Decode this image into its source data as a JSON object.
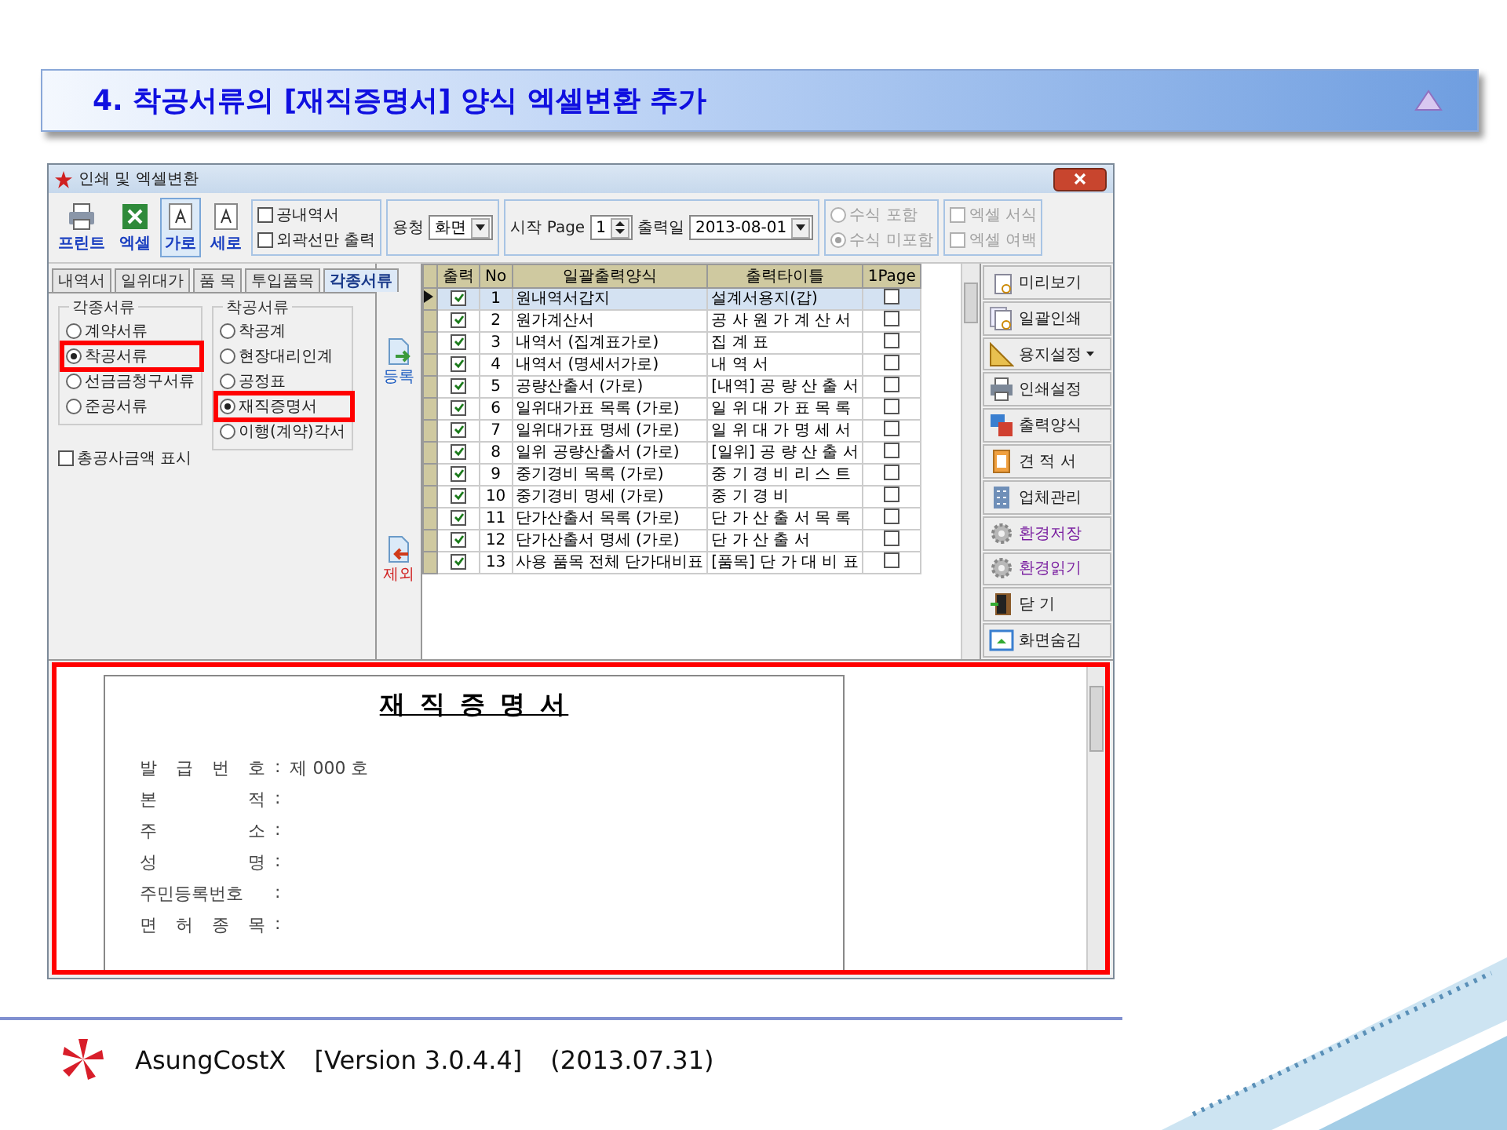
{
  "slide_title": "4. 착공서류의 [재직증명서] 양식 엑셀변환 추가",
  "window": {
    "title": "인쇄 및 엑셀변환"
  },
  "toolbar": {
    "tools": [
      {
        "label": "프린트",
        "kind": "printer",
        "selected": false
      },
      {
        "label": "엑셀",
        "kind": "excel",
        "selected": false
      },
      {
        "label": "가로",
        "kind": "landscape",
        "selected": true
      },
      {
        "label": "세로",
        "kind": "portrait",
        "selected": false
      }
    ],
    "print_options": [
      {
        "label": "공내역서",
        "checked": false
      },
      {
        "label": "외곽선만 출력",
        "checked": false
      }
    ],
    "view": {
      "label": "용청",
      "value": "화면"
    },
    "start_page": {
      "label": "시작 Page",
      "value": "1"
    },
    "print_date": {
      "label": "출력일",
      "value": "2013-08-01"
    },
    "formula_options": [
      {
        "label": "수식 포함",
        "selected": false,
        "disabled": true
      },
      {
        "label": "수식 미포함",
        "selected": true,
        "disabled": true
      }
    ],
    "excel_options": [
      {
        "label": "엑셀 서식",
        "checked": false,
        "disabled": true
      },
      {
        "label": "엑셀 여백",
        "checked": false,
        "disabled": true
      }
    ]
  },
  "tabs": [
    {
      "label": "내역서",
      "selected": false
    },
    {
      "label": "일위대가",
      "selected": false
    },
    {
      "label": "품 목",
      "selected": false
    },
    {
      "label": "투입품목",
      "selected": false
    },
    {
      "label": "각종서류",
      "selected": true
    }
  ],
  "doc_types": {
    "title": "각종서류",
    "options": [
      {
        "label": "계약서류",
        "selected": false,
        "highlighted": false
      },
      {
        "label": "착공서류",
        "selected": true,
        "highlighted": true
      },
      {
        "label": "선금금청구서류",
        "selected": false,
        "highlighted": false
      },
      {
        "label": "준공서류",
        "selected": false,
        "highlighted": false
      }
    ]
  },
  "show_total": {
    "label": "총공사금액 표시",
    "checked": false
  },
  "docs": {
    "title": "착공서류",
    "options": [
      {
        "label": "착공계",
        "selected": false,
        "highlighted": false
      },
      {
        "label": "현장대리인계",
        "selected": false,
        "highlighted": false
      },
      {
        "label": "공정표",
        "selected": false,
        "highlighted": false
      },
      {
        "label": "재직증명서",
        "selected": true,
        "highlighted": true
      },
      {
        "label": "이행(계약)각서",
        "selected": false,
        "highlighted": false
      }
    ]
  },
  "move_buttons": [
    {
      "label": "등록",
      "kind": "add"
    },
    {
      "label": "제외",
      "kind": "remove"
    }
  ],
  "table": {
    "columns": [
      "출력",
      "No",
      "일괄출력양식",
      "출력타이틀",
      "1Page"
    ],
    "rows": [
      {
        "print": true,
        "no": "1",
        "form": "원내역서갑지",
        "title": "설계서용지(갑)",
        "one_page": false,
        "selected": true
      },
      {
        "print": true,
        "no": "2",
        "form": "원가계산서",
        "title": "공 사 원 가 계 산 서",
        "one_page": false,
        "selected": false
      },
      {
        "print": true,
        "no": "3",
        "form": "내역서 (집계표가로)",
        "title": "집 계 표",
        "one_page": false,
        "selected": false
      },
      {
        "print": true,
        "no": "4",
        "form": "내역서 (명세서가로)",
        "title": "내 역 서",
        "one_page": false,
        "selected": false
      },
      {
        "print": true,
        "no": "5",
        "form": "공량산출서 (가로)",
        "title": "[내역] 공 량 산 출 서",
        "one_page": false,
        "selected": false
      },
      {
        "print": true,
        "no": "6",
        "form": "일위대가표 목록 (가로)",
        "title": "일 위 대 가 표 목 록",
        "one_page": false,
        "selected": false
      },
      {
        "print": true,
        "no": "7",
        "form": "일위대가표 명세 (가로)",
        "title": "일 위 대 가 명 세 서",
        "one_page": false,
        "selected": false
      },
      {
        "print": true,
        "no": "8",
        "form": "일위 공량산출서 (가로)",
        "title": "[일위] 공 량 산 출 서",
        "one_page": false,
        "selected": false
      },
      {
        "print": true,
        "no": "9",
        "form": "중기경비 목록 (가로)",
        "title": "중 기 경 비 리 스 트",
        "one_page": false,
        "selected": false
      },
      {
        "print": true,
        "no": "10",
        "form": "중기경비 명세 (가로)",
        "title": "중 기 경 비",
        "one_page": false,
        "selected": false
      },
      {
        "print": true,
        "no": "11",
        "form": "단가산출서 목록 (가로)",
        "title": "단 가 산 출 서 목 록",
        "one_page": false,
        "selected": false
      },
      {
        "print": true,
        "no": "12",
        "form": "단가산출서 명세 (가로)",
        "title": "단 가 산 출 서",
        "one_page": false,
        "selected": false
      },
      {
        "print": true,
        "no": "13",
        "form": "사용 품목 전체 단가대비표",
        "title": "[품목] 단 가 대 비 표",
        "one_page": false,
        "selected": false
      }
    ]
  },
  "side_buttons": [
    {
      "label": "미리보기",
      "kind": "page"
    },
    {
      "label": "일괄인쇄",
      "kind": "pages"
    },
    {
      "label": "용지설정",
      "kind": "ruler",
      "menu": true
    },
    {
      "label": "인쇄설정",
      "kind": "printer"
    },
    {
      "label": "출력양식",
      "kind": "windows"
    },
    {
      "label": "견 적 서",
      "kind": "sheet"
    },
    {
      "label": "업체관리",
      "kind": "building"
    },
    {
      "label": "환경저장",
      "kind": "gear",
      "accent": true
    },
    {
      "label": "환경읽기",
      "kind": "gear",
      "accent": true
    },
    {
      "label": "닫 기",
      "kind": "door"
    },
    {
      "label": "화면숨김",
      "kind": "screen"
    }
  ],
  "preview": {
    "title": "재 직 증 명 서",
    "highlighted": true,
    "fields": [
      {
        "label": "발 급 번 호",
        "sep": ":",
        "value": "제 000 호"
      },
      {
        "label": "본 적",
        "sep": ":"
      },
      {
        "label": "주 소",
        "sep": ":"
      },
      {
        "label": "성 명",
        "sep": ":"
      },
      {
        "label": "주민등록번호",
        "sep": ":"
      },
      {
        "label": "면 허 종 목",
        "sep": ":"
      }
    ]
  },
  "footer": {
    "product": "AsungCostX",
    "version": "[Version 3.0.4.4]",
    "date": "(2013.07.31)"
  }
}
